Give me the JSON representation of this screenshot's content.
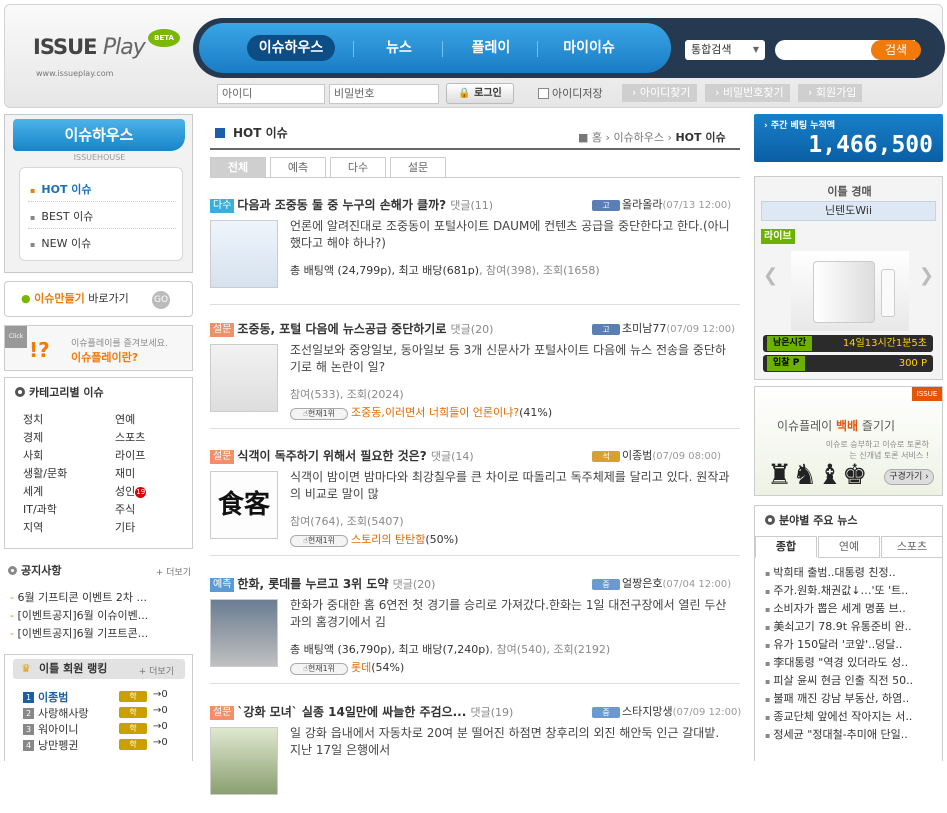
{
  "header": {
    "logo_main": "ISSUE",
    "logo_play": "Play",
    "logo_beta": "BETA",
    "logo_url": "www.issueplay.com",
    "nav": [
      "이슈하우스",
      "뉴스",
      "플레이",
      "마이이슈"
    ],
    "search_scope": "통합검색",
    "search_button": "검색",
    "login_id_placeholder": "아이디",
    "login_pw_placeholder": "비밀번호",
    "login_button": "로그인",
    "save_id": "아이디저장",
    "find_id": "아이디찾기",
    "find_pw": "비밀번호찾기",
    "signup": "회원가입"
  },
  "left": {
    "issuehouse_title": "이슈하우스",
    "issuehouse_sub": "ISSUEHOUSE",
    "issuehouse_items": [
      "HOT 이슈",
      "BEST 이슈",
      "NEW 이슈"
    ],
    "make_issue_prefix": "이슈만들기",
    "make_issue_suffix": " 바로가기",
    "make_issue_badge": "GO",
    "click_tag": "Click",
    "click_line1": "이슈플레이를 즐겨보세요.",
    "click_line2": "이슈플레이란?",
    "category_title": "카테고리별 이슈",
    "categories_left": [
      "정치",
      "경제",
      "사회",
      "생활/문화",
      "세계",
      "IT/과학",
      "지역"
    ],
    "categories_right": [
      "연예",
      "스포츠",
      "라이프",
      "재미",
      "성인",
      "주식",
      "기타"
    ],
    "adult_badge": "19",
    "notice_title": "공지사항",
    "notice_more": "+ 더보기",
    "notices": [
      "6월 기프티콘 이벤트 2차 ...",
      "[이벤트공지]6월 이슈이벤...",
      "[이벤트공지]6월 기프트콘..."
    ],
    "rank_title": "이틀 회원 랭킹",
    "rank_more": "+ 더보기",
    "ranks": [
      {
        "num": "1",
        "name": "이종범",
        "lvl": "학",
        "val": "0"
      },
      {
        "num": "2",
        "name": "사랑해사랑",
        "lvl": "학",
        "val": "0"
      },
      {
        "num": "3",
        "name": "워아이니",
        "lvl": "학",
        "val": "0"
      },
      {
        "num": "4",
        "name": "낭만펭귄",
        "lvl": "학",
        "val": "0"
      }
    ]
  },
  "center": {
    "title": "HOT 이슈",
    "breadcrumb_home": "홈",
    "breadcrumb_mid": "이슈하우스",
    "breadcrumb_current": "HOT 이슈",
    "tabs": [
      "전체",
      "예측",
      "다수",
      "설문"
    ],
    "posts": [
      {
        "tag": "다수",
        "tag_color": "#3ab0d8",
        "title": "다음과 조중동 둘 중 누구의 손해가 클까?",
        "comments": "댓글(11)",
        "lvl": "고",
        "lvl_color": "#5a7fb5",
        "author": "올라올라",
        "date": "(07/13 12:00)",
        "excerpt": "언론에 알려진대로 조중동이 포털사이트 DAUM에 컨텐츠 공급을 중단한다고 한다.(아니 했다고 해야 하나?)",
        "stats_label": "총 배팅액 (24,799p), 최고 배당(681p)",
        "stats_rest": ", 참여(398), 조회(1658)",
        "best_chip": "",
        "best_text": "",
        "best_pct": ""
      },
      {
        "tag": "설문",
        "tag_color": "#f0906a",
        "title": "조중동, 포털 다음에 뉴스공급 중단하기로",
        "comments": "댓글(20)",
        "lvl": "고",
        "lvl_color": "#5a7fb5",
        "author": "초미남77",
        "date": "(07/09 12:00)",
        "excerpt": "조선일보와 중앙일보, 동아일보 등 3개 신문사가 포털사이트 다음에 뉴스 전송을 중단하기로 해 논란이 일?",
        "stats_label": "",
        "stats_rest": "참여(533), 조회(2024)",
        "best_chip": "현재1위",
        "best_text": "조중동,이러면서 너희들이 언론이냐?",
        "best_pct": "(41%)"
      },
      {
        "tag": "설문",
        "tag_color": "#f0906a",
        "title": "식객이 독주하기 위해서 필요한 것은?",
        "comments": "댓글(14)",
        "lvl": "석",
        "lvl_color": "#d8a030",
        "author": "이종범",
        "date": "(07/09 08:00)",
        "excerpt": "식객이 밤이면 밤마다와 최강칠우를 큰 차이로 따돌리고 독주체제를 달리고 있다. 원작과의 비교로 말이 많",
        "stats_label": "",
        "stats_rest": "참여(764), 조회(5407)",
        "best_chip": "현재1위",
        "best_text": "스토리의 탄탄함",
        "best_pct": "(50%)"
      },
      {
        "tag": "예측",
        "tag_color": "#5b9bd5",
        "title": "한화, 롯데를 누르고 3위 도약",
        "comments": "댓글(20)",
        "lvl": "중",
        "lvl_color": "#6c9ad0",
        "author": "얼짱은호",
        "date": "(07/04 12:00)",
        "excerpt": "한화가 중대한 홈 6연전 첫 경기를 승리로 가져갔다.한화는 1일 대전구장에서 열린 두산과의 홈경기에서 김",
        "stats_label": "총 배팅액 (36,790p), 최고 배당(7,240p)",
        "stats_rest": ", 참여(540), 조회(2192)",
        "best_chip": "현재1위",
        "best_text": "롯데",
        "best_pct": "(54%)"
      },
      {
        "tag": "설문",
        "tag_color": "#f0906a",
        "title": "`강화 모녀` 실종 14일만에 싸늘한 주검으...",
        "comments": "댓글(19)",
        "lvl": "중",
        "lvl_color": "#6c9ad0",
        "author": "스타지망생",
        "date": "(07/09 12:00)",
        "excerpt": "일 강화 읍내에서 자동차로 20여 분 떨어진 하점면 창후리의 외진 해안둑 인근 갈대밭.지난 17일 은행에서",
        "stats_label": "",
        "stats_rest": "",
        "best_chip": "",
        "best_text": "",
        "best_pct": ""
      }
    ]
  },
  "right": {
    "bet_total_label": "주간 베팅 누적액",
    "bet_total_value": "1,466,500",
    "auction_title": "이틀 경매",
    "auction_item": "닌텐도Wii",
    "live_badge": "라이브",
    "remaining_label": "남은시간",
    "remaining_value": "14일13시간1분5초",
    "bid_label": "입찰 P",
    "bid_value": "300 P",
    "event_corner": "ISSUE",
    "event_line1_prefix": "이슈플레이 ",
    "event_line1_bold": "백배",
    "event_line1_suffix": " 즐기기",
    "event_line2": "이슈로 승부하고 이슈로 토론하는 신개념 토론 서비스 !",
    "event_button": "구경가기 ›",
    "news_title": "분야별 주요 뉴스",
    "news_tabs": [
      "종합",
      "연예",
      "스포츠"
    ],
    "news": [
      "박희태 출범..대통령 친정..",
      "주가.원화.채권값↓…'또 '트..",
      "소비자가 뽑은 세계 명품 브..",
      "美쇠고기 78.9t 유통준비 완..",
      "유가 150달러 '코앞'..덩달..",
      "李대통령 \"역경 있더라도 성..",
      "피살 윤씨 현금 인출 직전 50..",
      "불패 깨진 강남 부동산, 하염..",
      "종교단체 앞에선 작아지는 서..",
      "정세균 \"정대철-추미애 단일.."
    ]
  }
}
